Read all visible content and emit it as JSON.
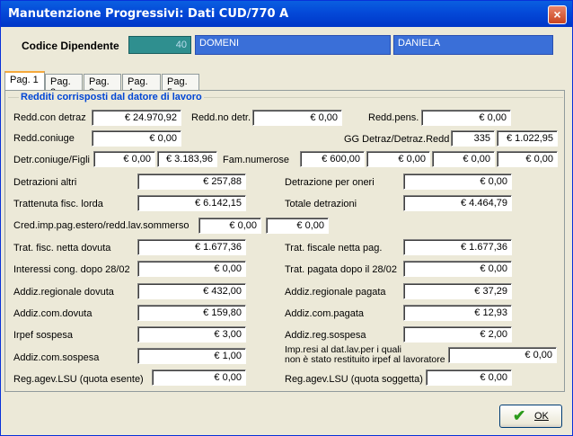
{
  "window": {
    "title": "Manutenzione Progressivi: Dati  CUD/770  A",
    "close_glyph": "×"
  },
  "employee": {
    "label": "Codice Dipendente",
    "code": "40",
    "surname": "DOMENI",
    "name": "DANIELA"
  },
  "tabs": [
    "Pag. 1",
    "Pag. 2",
    "Pag. 3",
    "Pag. 4",
    "Pag. 5"
  ],
  "active_tab": "Pag. 1",
  "group_title": "Redditi corrisposti dal datore di lavoro",
  "labels": {
    "redd_con_detraz": "Redd.con detraz",
    "redd_no_detr": "Redd.no detr.",
    "redd_pens": "Redd.pens.",
    "redd_coniuge": "Redd.coniuge",
    "gg_detraz": "GG Detraz/Detraz.Redd",
    "detr_coniuge_figli": "Detr.coniuge/Figli",
    "fam_numerose": "Fam.numerose",
    "detrazioni_altri": "Detrazioni altri",
    "detrazione_oneri": "Detrazione per oneri",
    "trattenuta_lorda": "Trattenuta fisc. lorda",
    "totale_detrazioni": "Totale detrazioni",
    "cred_imp": "Cred.imp.pag.estero/redd.lav.sommerso",
    "trat_netta_dovuta": "Trat. fisc. netta dovuta",
    "trat_netta_pag": "Trat. fiscale  netta pag.",
    "interessi_cong": "Interessi cong. dopo 28/02",
    "trat_pagata_dopo": "Trat. pagata dopo il 28/02",
    "addiz_reg_dovuta": "Addiz.regionale dovuta",
    "addiz_reg_pagata": "Addiz.regionale pagata",
    "addiz_com_dovuta": "Addiz.com.dovuta",
    "addiz_com_pagata": "Addiz.com.pagata",
    "irpef_sospesa": "Irpef sospesa",
    "addiz_reg_sospesa": "Addiz.reg.sospesa",
    "addiz_com_sospesa": "Addiz.com.sospesa",
    "imp_resi_1": "Imp.resi al dat.lav.per i quali",
    "imp_resi_2": "non è stato restituito irpef al lavoratore",
    "lsu_esente": "Reg.agev.LSU (quota esente)",
    "lsu_soggetta": "Reg.agev.LSU (quota soggetta)"
  },
  "values": {
    "redd_con_detraz": "€ 24.970,92",
    "redd_no_detr": "€ 0,00",
    "redd_pens": "€ 0,00",
    "redd_coniuge": "€ 0,00",
    "gg_detraz": "335",
    "detraz_redd": "€ 1.022,95",
    "detr_coniuge": "€ 0,00",
    "detr_figli": "€ 3.183,96",
    "fam_numerose_1": "€ 600,00",
    "fam_numerose_2": "€ 0,00",
    "fam_numerose_3": "€ 0,00",
    "fam_numerose_4": "€ 0,00",
    "detrazioni_altri": "€ 257,88",
    "detrazione_oneri": "€ 0,00",
    "trattenuta_lorda": "€ 6.142,15",
    "totale_detrazioni": "€ 4.464,79",
    "cred_imp_1": "€ 0,00",
    "cred_imp_2": "€ 0,00",
    "trat_netta_dovuta": "€ 1.677,36",
    "trat_netta_pag": "€ 1.677,36",
    "interessi_cong": "€ 0,00",
    "trat_pagata_dopo": "€ 0,00",
    "addiz_reg_dovuta": "€ 432,00",
    "addiz_reg_pagata": "€ 37,29",
    "addiz_com_dovuta": "€ 159,80",
    "addiz_com_pagata": "€ 12,93",
    "irpef_sospesa": "€ 3,00",
    "addiz_reg_sospesa": "€ 2,00",
    "addiz_com_sospesa": "€ 1,00",
    "imp_resi": "€ 0,00",
    "lsu_esente": "€ 0,00",
    "lsu_soggetta": "€ 0,00"
  },
  "ok_button": {
    "label": "OK",
    "icon": "checkmark-icon"
  }
}
